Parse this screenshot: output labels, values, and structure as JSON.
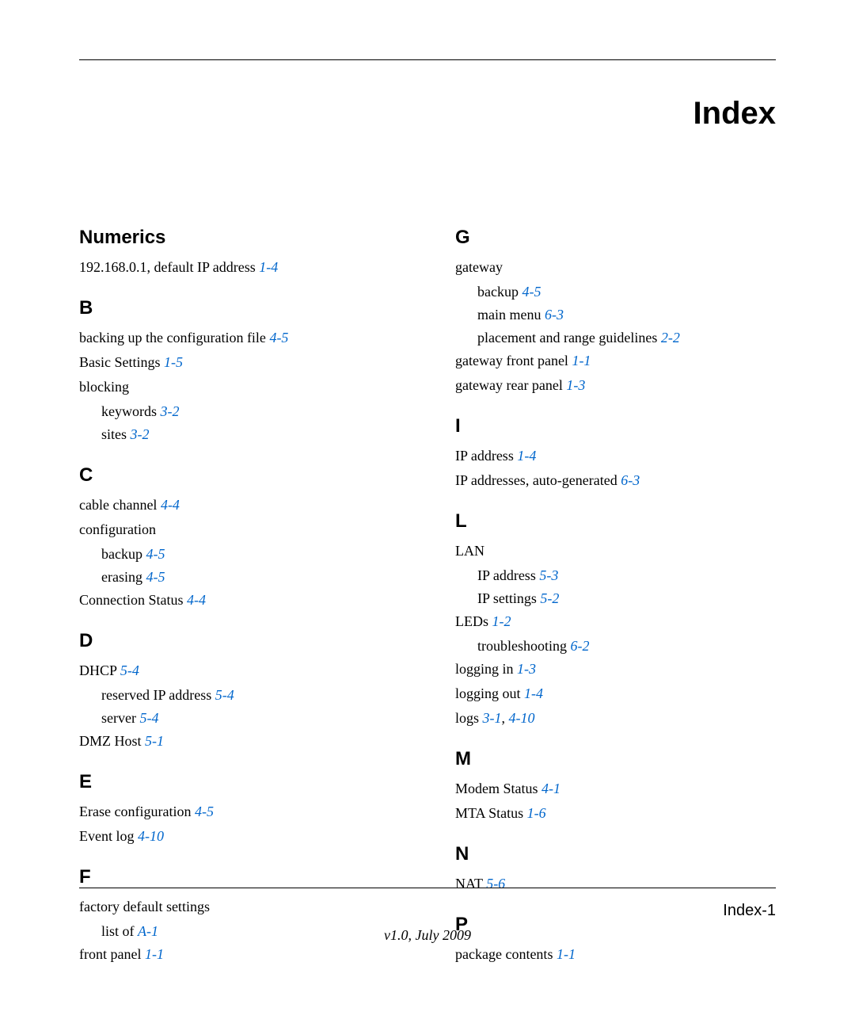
{
  "page": {
    "title": "Index",
    "page_number": "Index-1",
    "version": "v1.0, July 2009"
  },
  "left_column": [
    {
      "heading": "Numerics",
      "items": [
        {
          "text": "192.168.0.1, default IP address",
          "refs": [
            "1-4"
          ]
        }
      ]
    },
    {
      "heading": "B",
      "items": [
        {
          "text": "backing up the configuration file",
          "refs": [
            "4-5"
          ]
        },
        {
          "text": "Basic Settings",
          "refs": [
            "1-5"
          ]
        },
        {
          "text": "blocking",
          "refs": [],
          "subs": [
            {
              "text": "keywords",
              "refs": [
                "3-2"
              ]
            },
            {
              "text": "sites",
              "refs": [
                "3-2"
              ]
            }
          ]
        }
      ]
    },
    {
      "heading": "C",
      "items": [
        {
          "text": "cable channel",
          "refs": [
            "4-4"
          ]
        },
        {
          "text": "configuration",
          "refs": [],
          "subs": [
            {
              "text": "backup",
              "refs": [
                "4-5"
              ]
            },
            {
              "text": "erasing",
              "refs": [
                "4-5"
              ]
            }
          ]
        },
        {
          "text": "Connection Status",
          "refs": [
            "4-4"
          ]
        }
      ]
    },
    {
      "heading": "D",
      "items": [
        {
          "text": "DHCP",
          "refs": [
            "5-4"
          ],
          "subs": [
            {
              "text": "reserved IP address",
              "refs": [
                "5-4"
              ]
            },
            {
              "text": "server",
              "refs": [
                "5-4"
              ]
            }
          ]
        },
        {
          "text": "DMZ Host",
          "refs": [
            "5-1"
          ]
        }
      ]
    },
    {
      "heading": "E",
      "items": [
        {
          "text": "Erase configuration",
          "refs": [
            "4-5"
          ]
        },
        {
          "text": "Event log",
          "refs": [
            "4-10"
          ]
        }
      ]
    },
    {
      "heading": "F",
      "items": [
        {
          "text": "factory default settings",
          "refs": [],
          "subs": [
            {
              "text": "list of",
              "refs": [
                "A-1"
              ]
            }
          ]
        },
        {
          "text": "front panel",
          "refs": [
            "1-1"
          ]
        }
      ]
    }
  ],
  "right_column": [
    {
      "heading": "G",
      "items": [
        {
          "text": "gateway",
          "refs": [],
          "subs": [
            {
              "text": "backup",
              "refs": [
                "4-5"
              ]
            },
            {
              "text": "main menu",
              "refs": [
                "6-3"
              ]
            },
            {
              "text": "placement and range guidelines",
              "refs": [
                "2-2"
              ]
            }
          ]
        },
        {
          "text": "gateway front panel",
          "refs": [
            "1-1"
          ]
        },
        {
          "text": "gateway rear panel",
          "refs": [
            "1-3"
          ]
        }
      ]
    },
    {
      "heading": "I",
      "items": [
        {
          "text": "IP address",
          "refs": [
            "1-4"
          ]
        },
        {
          "text": "IP addresses, auto-generated",
          "refs": [
            "6-3"
          ]
        }
      ]
    },
    {
      "heading": "L",
      "items": [
        {
          "text": "LAN",
          "refs": [],
          "subs": [
            {
              "text": "IP address",
              "refs": [
                "5-3"
              ]
            },
            {
              "text": "IP settings",
              "refs": [
                "5-2"
              ]
            }
          ]
        },
        {
          "text": "LEDs",
          "refs": [
            "1-2"
          ],
          "subs": [
            {
              "text": "troubleshooting",
              "refs": [
                "6-2"
              ]
            }
          ]
        },
        {
          "text": "logging in",
          "refs": [
            "1-3"
          ]
        },
        {
          "text": "logging out",
          "refs": [
            "1-4"
          ]
        },
        {
          "text": "logs",
          "refs": [
            "3-1",
            "4-10"
          ]
        }
      ]
    },
    {
      "heading": "M",
      "items": [
        {
          "text": "Modem Status",
          "refs": [
            "4-1"
          ]
        },
        {
          "text": "MTA Status",
          "refs": [
            "1-6"
          ]
        }
      ]
    },
    {
      "heading": "N",
      "items": [
        {
          "text": "NAT",
          "refs": [
            "5-6"
          ]
        }
      ]
    },
    {
      "heading": "P",
      "items": [
        {
          "text": "package contents",
          "refs": [
            "1-1"
          ]
        }
      ]
    }
  ]
}
